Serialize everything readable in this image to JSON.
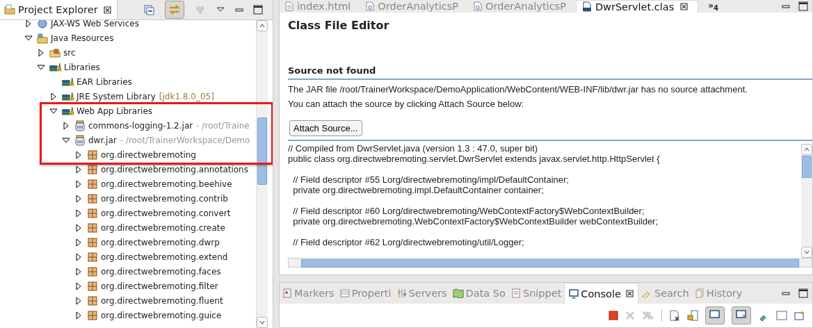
{
  "explorer": {
    "title": "Project Explorer",
    "tree": [
      {
        "label": "JAX-WS Web Services",
        "kind": "webservices",
        "expanded": false
      },
      {
        "label": "Java Resources",
        "kind": "resources",
        "expanded": true,
        "children": [
          {
            "label": "src",
            "kind": "folder",
            "expanded": false
          },
          {
            "label": "Libraries",
            "kind": "library",
            "expanded": true,
            "children": [
              {
                "label": "EAR Libraries",
                "kind": "library"
              },
              {
                "label": "JRE System Library",
                "decoration": "[jdk1.8.0_05]",
                "kind": "library",
                "expanded": false
              },
              {
                "label": "Web App Libraries",
                "kind": "library",
                "expanded": true,
                "children": [
                  {
                    "label": "commons-logging-1.2.jar",
                    "decoration": "- /root/Traine",
                    "kind": "jar",
                    "expanded": false
                  },
                  {
                    "label": "dwr.jar",
                    "decoration": "- /root/TrainerWorkspace/Demo",
                    "kind": "jar",
                    "expanded": true,
                    "children": [
                      {
                        "label": "org.directwebremoting",
                        "kind": "package",
                        "expanded": false
                      },
                      {
                        "label": "org.directwebremoting.annotations",
                        "kind": "package",
                        "expanded": false
                      },
                      {
                        "label": "org.directwebremoting.beehive",
                        "kind": "package",
                        "expanded": false
                      },
                      {
                        "label": "org.directwebremoting.contrib",
                        "kind": "package",
                        "expanded": false
                      },
                      {
                        "label": "org.directwebremoting.convert",
                        "kind": "package",
                        "expanded": false
                      },
                      {
                        "label": "org.directwebremoting.create",
                        "kind": "package",
                        "expanded": false
                      },
                      {
                        "label": "org.directwebremoting.dwrp",
                        "kind": "package",
                        "expanded": false
                      },
                      {
                        "label": "org.directwebremoting.extend",
                        "kind": "package",
                        "expanded": false
                      },
                      {
                        "label": "org.directwebremoting.faces",
                        "kind": "package",
                        "expanded": false
                      },
                      {
                        "label": "org.directwebremoting.filter",
                        "kind": "package",
                        "expanded": false
                      },
                      {
                        "label": "org.directwebremoting.fluent",
                        "kind": "package",
                        "expanded": false
                      },
                      {
                        "label": "org.directwebremoting.guice",
                        "kind": "package",
                        "expanded": false
                      }
                    ]
                  }
                ]
              }
            ]
          }
        ]
      }
    ]
  },
  "editor": {
    "tabs": [
      {
        "label": "index.html",
        "kind": "html",
        "selected": false
      },
      {
        "label": "OrderAnalyticsP",
        "kind": "java",
        "selected": false
      },
      {
        "label": "OrderAnalyticsP",
        "kind": "java",
        "selected": false
      },
      {
        "label": "DwrServlet.clas",
        "kind": "class",
        "selected": true
      }
    ],
    "overflow": "»$_{4}$",
    "title": "Class File Editor",
    "section": "Source not found",
    "message": [
      "The JAR file /root/TrainerWorkspace/DemoApplication/WebContent/WEB-INF/lib/dwr.jar has no source attachment.",
      "You can attach the source by clicking Attach Source below:"
    ],
    "button": "Attach Source...",
    "code_blocks": [
      [
        "// Compiled from DwrServlet.java (version 1.3 : 47.0, super bit)",
        "public class org.directwebremoting.servlet.DwrServlet extends javax.servlet.http.HttpServlet {"
      ],
      [
        "  // Field descriptor #55 Lorg/directwebremoting/impl/DefaultContainer;",
        "  private org.directwebremoting.impl.DefaultContainer container;"
      ],
      [
        "  // Field descriptor #60 Lorg/directwebremoting/WebContextFactory$WebContextBuilder;",
        "  private org.directwebremoting.WebContextFactory$WebContextBuilder webContextBuilder;"
      ],
      [
        "  // Field descriptor #62 Lorg/directwebremoting/util/Logger;"
      ]
    ]
  },
  "bottom": {
    "tabs": [
      {
        "label": "Markers",
        "kind": "markers",
        "selected": false
      },
      {
        "label": "Properti",
        "kind": "properties",
        "selected": false
      },
      {
        "label": "Servers",
        "kind": "servers",
        "selected": false
      },
      {
        "label": "Data So",
        "kind": "data",
        "selected": false
      },
      {
        "label": "Snippet",
        "kind": "snippet",
        "selected": false
      },
      {
        "label": "Console",
        "kind": "console",
        "selected": true
      },
      {
        "label": "Search",
        "kind": "search",
        "selected": false
      },
      {
        "label": "History",
        "kind": "history",
        "selected": false
      }
    ]
  }
}
